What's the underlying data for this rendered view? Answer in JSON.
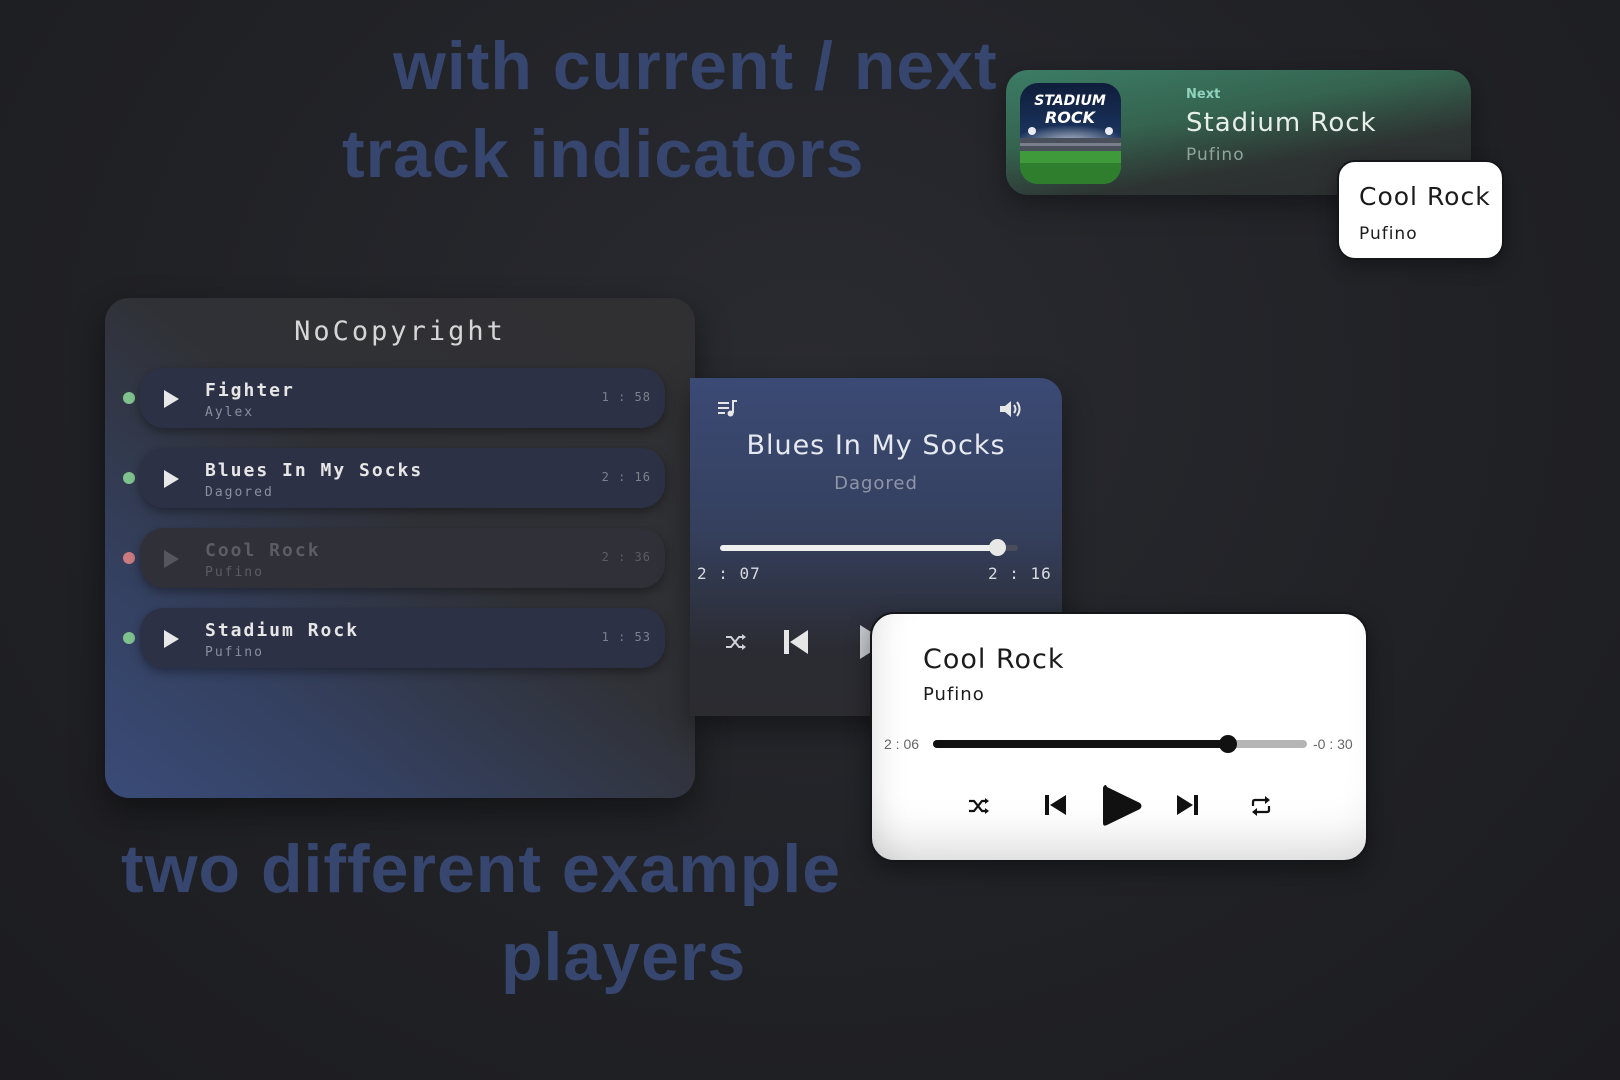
{
  "headlines": {
    "top_line1": "with current / next",
    "top_line2": "track indicators",
    "bottom_line1": "two different example",
    "bottom_line2": "players"
  },
  "next_notification": {
    "label": "Next",
    "title": "Stadium Rock",
    "artist": "Pufino",
    "cover_text_line1": "STADIUM",
    "cover_text_line2": "ROCK",
    "accent_color": "#3c7c66"
  },
  "current_popup": {
    "title": "Cool Rock",
    "artist": "Pufino"
  },
  "playlist": {
    "title": "NoCopyright",
    "tracks": [
      {
        "name": "Fighter",
        "artist": "Aylex",
        "duration": "1 : 58",
        "status_color": "#7fc28e",
        "dimmed": false
      },
      {
        "name": "Blues In My Socks",
        "artist": "Dagored",
        "duration": "2 : 16",
        "status_color": "#7fc28e",
        "dimmed": false
      },
      {
        "name": "Cool Rock",
        "artist": "Pufino",
        "duration": "2 : 36",
        "status_color": "#c97b80",
        "dimmed": true
      },
      {
        "name": "Stadium Rock",
        "artist": "Pufino",
        "duration": "1 : 53",
        "status_color": "#7fc28e",
        "dimmed": false
      }
    ]
  },
  "dark_player": {
    "title": "Blues In My Socks",
    "artist": "Dagored",
    "elapsed": "2 : 07",
    "total": "2 : 16",
    "progress": 0.93,
    "icons": [
      "playlist-icon",
      "volume-icon",
      "shuffle-icon",
      "previous-icon",
      "play-icon"
    ]
  },
  "light_player": {
    "title": "Cool Rock",
    "artist": "Pufino",
    "elapsed": "2 : 06",
    "remaining": "-0 : 30",
    "progress": 0.79,
    "icons": [
      "shuffle-icon",
      "previous-icon",
      "play-icon",
      "next-icon",
      "repeat-icon"
    ]
  }
}
